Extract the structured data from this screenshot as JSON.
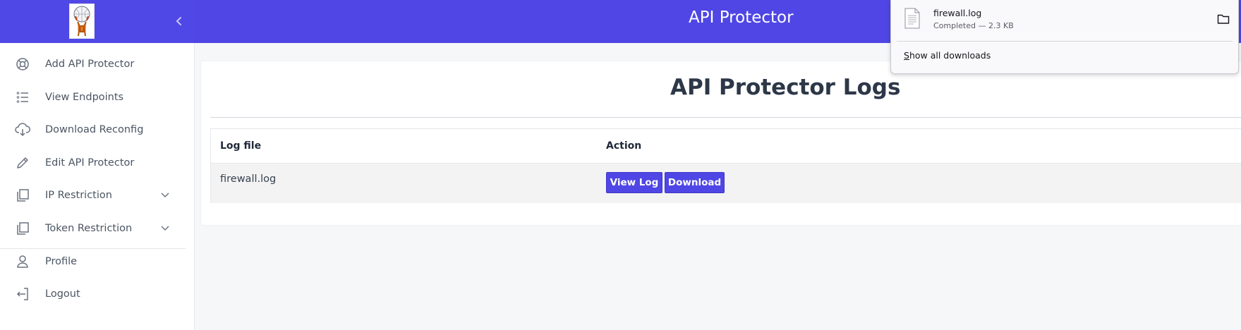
{
  "header": {
    "app_title": "API Protector",
    "logo_icon": "atlas-logo-icon",
    "collapse_icon": "chevron-left-icon",
    "bg_color": "#4f46e5"
  },
  "sidebar": {
    "items": [
      {
        "label": "Add API Protector",
        "icon": "lifebuoy-icon"
      },
      {
        "label": "View Endpoints",
        "icon": "list-icon"
      },
      {
        "label": "Download Reconfig",
        "icon": "cloud-download-icon"
      },
      {
        "label": "Edit API Protector",
        "icon": "pencil-icon"
      },
      {
        "label": "IP Restriction",
        "icon": "copy-icon",
        "expandable": true
      },
      {
        "label": "Token Restriction",
        "icon": "copy-icon",
        "expandable": true
      },
      {
        "label": "Profile",
        "icon": "user-icon"
      },
      {
        "label": "Logout",
        "icon": "logout-icon"
      }
    ]
  },
  "main": {
    "title": "API Protector Logs",
    "table": {
      "columns": [
        "Log file",
        "Action"
      ],
      "rows": [
        {
          "file": "firewall.log",
          "actions": [
            "View Log",
            "Download"
          ]
        }
      ]
    },
    "button_color": "#4f46e5"
  },
  "downloads_panel": {
    "file_name": "firewall.log",
    "status": "Completed — 2.3 KB",
    "show_all_label_first": "S",
    "show_all_label_rest": "how all downloads",
    "file_icon": "document-icon",
    "folder_icon": "folder-icon"
  }
}
